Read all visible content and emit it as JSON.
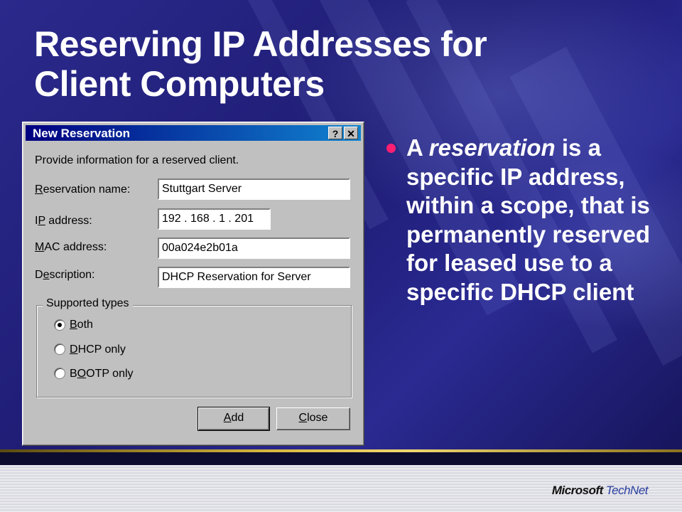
{
  "slide": {
    "title_line1": "Reserving IP Addresses for",
    "title_line2": "Client Computers",
    "bullet_prefix": "A ",
    "bullet_emph": "reservation",
    "bullet_rest": " is a specific IP address, within a scope, that is permanently reserved for leased use to a specific DHCP client",
    "bullet_color": "#ff1f72",
    "logo_word1": "Microsoft",
    "logo_word2": "TechNet"
  },
  "dialog": {
    "title": "New Reservation",
    "help_label": "?",
    "close_label": "✕",
    "intro": "Provide information for a reserved client.",
    "fields": {
      "reservation_name": {
        "label_u": "R",
        "label_rest": "eservation name:",
        "value": "Stuttgart Server"
      },
      "ip_address": {
        "label_pre": "I",
        "label_u": "P",
        "label_rest": " address:",
        "value": "192 . 168 . 1 . 201"
      },
      "mac_address": {
        "label_u": "M",
        "label_rest": "AC address:",
        "value": "00a024e2b01a"
      },
      "description": {
        "label_pre": "D",
        "label_u": "e",
        "label_rest": "scription:",
        "value": "DHCP Reservation for Server"
      }
    },
    "supported_types": {
      "legend": "Supported types",
      "options": [
        {
          "u": "B",
          "rest": "oth",
          "selected": true
        },
        {
          "u": "D",
          "rest": "HCP only",
          "selected": false
        },
        {
          "pre": "B",
          "u": "O",
          "rest": "OTP only",
          "selected": false
        }
      ]
    },
    "buttons": {
      "add": {
        "u": "A",
        "rest": "dd"
      },
      "close": {
        "u": "C",
        "rest": "lose"
      }
    }
  }
}
